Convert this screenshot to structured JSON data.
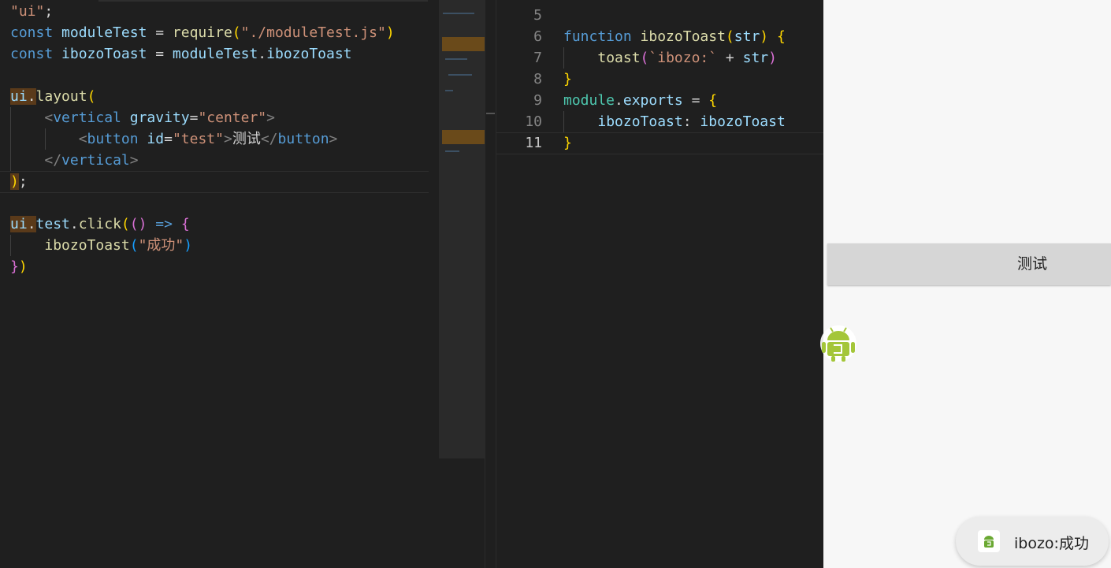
{
  "left_editor": {
    "lines": [
      [
        {
          "t": "\"ui\"",
          "c": "str"
        },
        {
          "t": ";",
          "c": "plain"
        }
      ],
      [
        {
          "t": "const ",
          "c": "kw"
        },
        {
          "t": "moduleTest",
          "c": "var"
        },
        {
          "t": " = ",
          "c": "plain"
        },
        {
          "t": "require",
          "c": "fn"
        },
        {
          "t": "(",
          "c": "br1"
        },
        {
          "t": "\"./moduleTest.js\"",
          "c": "str"
        },
        {
          "t": ")",
          "c": "br1"
        }
      ],
      [
        {
          "t": "const ",
          "c": "kw"
        },
        {
          "t": "ibozoToast",
          "c": "var"
        },
        {
          "t": " = ",
          "c": "plain"
        },
        {
          "t": "moduleTest",
          "c": "var"
        },
        {
          "t": ".",
          "c": "plain"
        },
        {
          "t": "ibozoToast",
          "c": "var"
        }
      ],
      [],
      [
        {
          "t": "ui",
          "c": "var hl"
        },
        {
          "t": ".",
          "c": "plain hl"
        },
        {
          "t": "layout",
          "c": "fn"
        },
        {
          "t": "(",
          "c": "br1"
        }
      ],
      [
        {
          "t": "    ",
          "c": "plain"
        },
        {
          "t": "<",
          "c": "tag"
        },
        {
          "t": "vertical",
          "c": "tagname"
        },
        {
          "t": " ",
          "c": "plain"
        },
        {
          "t": "gravity",
          "c": "attr"
        },
        {
          "t": "=",
          "c": "plain"
        },
        {
          "t": "\"center\"",
          "c": "str"
        },
        {
          "t": ">",
          "c": "tag"
        }
      ],
      [
        {
          "t": "        ",
          "c": "plain"
        },
        {
          "t": "<",
          "c": "tag"
        },
        {
          "t": "button",
          "c": "tagname"
        },
        {
          "t": " ",
          "c": "plain"
        },
        {
          "t": "id",
          "c": "attr"
        },
        {
          "t": "=",
          "c": "plain"
        },
        {
          "t": "\"test\"",
          "c": "str"
        },
        {
          "t": ">",
          "c": "tag"
        },
        {
          "t": "测试",
          "c": "plain"
        },
        {
          "t": "</",
          "c": "tag"
        },
        {
          "t": "button",
          "c": "tagname"
        },
        {
          "t": ">",
          "c": "tag"
        }
      ],
      [
        {
          "t": "    ",
          "c": "plain"
        },
        {
          "t": "</",
          "c": "tag"
        },
        {
          "t": "vertical",
          "c": "tagname"
        },
        {
          "t": ">",
          "c": "tag"
        }
      ],
      [
        {
          "t": ")",
          "c": "br1 hl"
        },
        {
          "t": ";",
          "c": "plain"
        }
      ],
      [],
      [
        {
          "t": "ui",
          "c": "var hl"
        },
        {
          "t": ".",
          "c": "plain hl"
        },
        {
          "t": "test",
          "c": "var"
        },
        {
          "t": ".",
          "c": "plain"
        },
        {
          "t": "click",
          "c": "fn"
        },
        {
          "t": "(",
          "c": "br1"
        },
        {
          "t": "()",
          "c": "br2"
        },
        {
          "t": " => ",
          "c": "kw"
        },
        {
          "t": "{",
          "c": "br2"
        }
      ],
      [
        {
          "t": "    ",
          "c": "plain"
        },
        {
          "t": "ibozoToast",
          "c": "fn"
        },
        {
          "t": "(",
          "c": "br3"
        },
        {
          "t": "\"成功\"",
          "c": "str"
        },
        {
          "t": ")",
          "c": "br3"
        }
      ],
      [
        {
          "t": "}",
          "c": "br2"
        },
        {
          "t": ")",
          "c": "br1"
        }
      ]
    ]
  },
  "right_editor": {
    "line_numbers": [
      "5",
      "6",
      "7",
      "8",
      "9",
      "10",
      "11"
    ],
    "active_line": "11",
    "lines": [
      [],
      [
        {
          "t": "function ",
          "c": "kw"
        },
        {
          "t": "ibozoToast",
          "c": "fn"
        },
        {
          "t": "(",
          "c": "br1"
        },
        {
          "t": "str",
          "c": "var"
        },
        {
          "t": ")",
          "c": "br1"
        },
        {
          "t": " ",
          "c": "plain"
        },
        {
          "t": "{",
          "c": "br1"
        }
      ],
      [
        {
          "t": "    ",
          "c": "plain"
        },
        {
          "t": "toast",
          "c": "fn"
        },
        {
          "t": "(",
          "c": "br2"
        },
        {
          "t": "`ibozo:`",
          "c": "str"
        },
        {
          "t": " + ",
          "c": "plain"
        },
        {
          "t": "str",
          "c": "var"
        },
        {
          "t": ")",
          "c": "br2"
        }
      ],
      [
        {
          "t": "}",
          "c": "br1"
        }
      ],
      [
        {
          "t": "module",
          "c": "prop"
        },
        {
          "t": ".",
          "c": "plain"
        },
        {
          "t": "exports",
          "c": "var"
        },
        {
          "t": " = ",
          "c": "plain"
        },
        {
          "t": "{",
          "c": "br1"
        }
      ],
      [
        {
          "t": "    ",
          "c": "plain"
        },
        {
          "t": "ibozoToast",
          "c": "var"
        },
        {
          "t": ": ",
          "c": "plain"
        },
        {
          "t": "ibozoToast",
          "c": "var"
        }
      ],
      [
        {
          "t": "}",
          "c": "br1"
        }
      ]
    ]
  },
  "phone": {
    "button_label": "测试",
    "toast_text": "ibozo:成功",
    "float_icon": "android-icon",
    "toast_icon": "app-icon"
  },
  "colors": {
    "editor_bg": "#1f1f1f",
    "phone_bg": "#f7f7f7",
    "android_green": "#a4c639"
  }
}
